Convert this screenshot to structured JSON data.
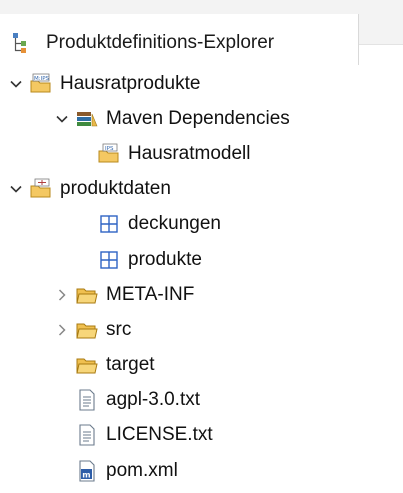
{
  "view": {
    "title": "Produktdefinitions-Explorer",
    "icon": "project-structure-icon"
  },
  "tree": [
    {
      "label": "Hausratprodukte",
      "icon": "ips-project-folder-icon",
      "expanded": true
    },
    {
      "label": "Maven Dependencies",
      "icon": "library-container-icon",
      "expanded": true
    },
    {
      "label": "Hausratmodell",
      "icon": "ips-model-folder-icon"
    },
    {
      "label": "produktdaten",
      "icon": "ips-package-folder-icon",
      "expanded": true
    },
    {
      "label": "deckungen",
      "icon": "package-grid-icon"
    },
    {
      "label": "produkte",
      "icon": "package-grid-icon"
    },
    {
      "label": "META-INF",
      "icon": "folder-icon",
      "expanded": false
    },
    {
      "label": "src",
      "icon": "folder-icon",
      "expanded": false
    },
    {
      "label": "target",
      "icon": "folder-icon"
    },
    {
      "label": "agpl-3.0.txt",
      "icon": "text-file-icon"
    },
    {
      "label": "LICENSE.txt",
      "icon": "text-file-icon"
    },
    {
      "label": "pom.xml",
      "icon": "maven-pom-icon"
    }
  ]
}
